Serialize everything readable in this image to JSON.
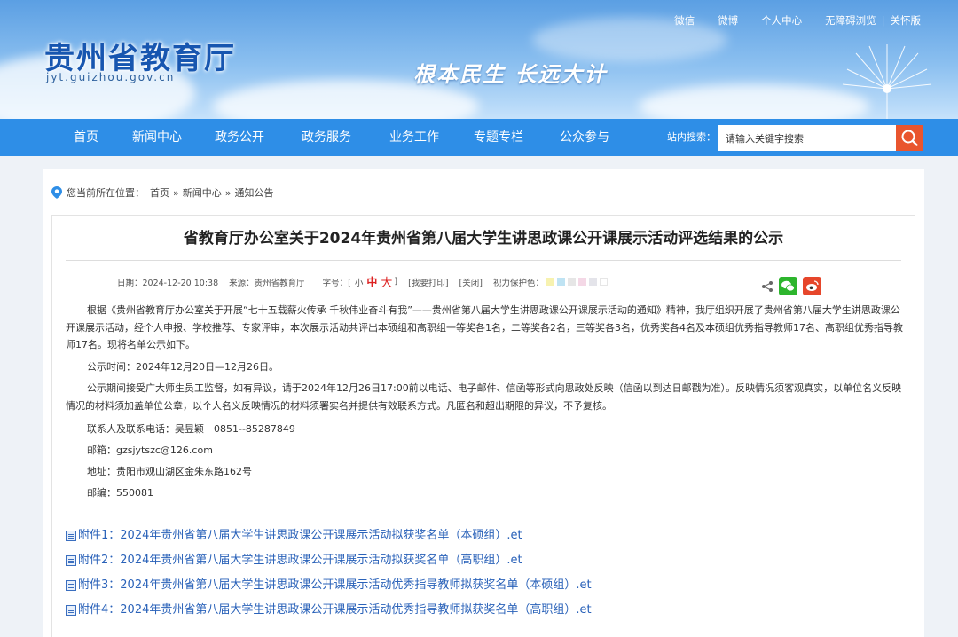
{
  "header": {
    "site_title": "贵州省教育厅",
    "site_url": "jyt.guizhou.gov.cn",
    "slogan": "根本民生 长远大计",
    "top_links": [
      "微信",
      "微博",
      "个人中心",
      "无障碍浏览",
      "|",
      "关怀版"
    ]
  },
  "nav": {
    "items": [
      "首页",
      "新闻中心",
      "政务公开",
      "政务服务",
      "业务工作",
      "专题专栏",
      "公众参与"
    ],
    "search_label": "站内搜索：",
    "search_value": "请输入关键字搜索"
  },
  "breadcrumb": {
    "prefix": "您当前所在位置：",
    "items": [
      "首页",
      "新闻中心",
      "通知公告"
    ],
    "separator": "»"
  },
  "article": {
    "title": "省教育厅办公室关于2024年贵州省第八届大学生讲思政课公开课展示活动评选结果的公示",
    "meta": {
      "date": "日期：2024-12-20 10:38",
      "source": "来源：贵州省教育厅",
      "font_label": "字号：[",
      "font_small": "小",
      "font_medium": "中",
      "font_large": "大",
      "font_end": "]",
      "print": "[我要打印]",
      "close": "[关闭]",
      "eye_label": "视力保护色："
    },
    "eye_colors": [
      "#f7f2b0",
      "#bfe3f3",
      "#e6e6e6",
      "#f4d8e6",
      "#e4e4ea",
      "#ffffff"
    ],
    "paragraphs": [
      "根据《贵州省教育厅办公室关于开展“七十五载薪火传承 千秋伟业奋斗有我”——贵州省第八届大学生讲思政课公开课展示活动的通知》精神，我厅组织开展了贵州省第八届大学生讲思政课公开课展示活动，经个人申报、学校推荐、专家评审，本次展示活动共评出本硕组和高职组一等奖各1名，二等奖各2名，三等奖各3名，优秀奖各4名及本硕组优秀指导教师17名、高职组优秀指导教师17名。现将名单公示如下。",
      "公示时间：2024年12月20日—12月26日。",
      "公示期间接受广大师生员工监督，如有异议，请于2024年12月26日17:00前以电话、电子邮件、信函等形式向思政处反映（信函以到达日邮戳为准）。反映情况须客观真实，以单位名义反映情况的材料须加盖单位公章，以个人名义反映情况的材料须署实名并提供有效联系方式。凡匿名和超出期限的异议，不予复核。"
    ],
    "contacts": [
      "联系人及联系电话：吴昱颖　0851--85287849",
      "邮箱：gzsjytszc@126.com",
      "地址：贵阳市观山湖区金朱东路162号",
      "邮编：550081"
    ],
    "attachments": [
      "附件1：2024年贵州省第八届大学生讲思政课公开课展示活动拟获奖名单（本硕组）.et",
      "附件2：2024年贵州省第八届大学生讲思政课公开课展示活动拟获奖名单（高职组）.et",
      "附件3：2024年贵州省第八届大学生讲思政课公开课展示活动优秀指导教师拟获奖名单（本硕组）.et",
      "附件4：2024年贵州省第八届大学生讲思政课公开课展示活动优秀指导教师拟获奖名单（高职组）.et"
    ]
  },
  "colors": {
    "nav": "#2e8ee7",
    "search_button": "#e9552e",
    "link": "#2a62b9",
    "wechat": "#2db52d",
    "weibo": "#e6462b"
  }
}
